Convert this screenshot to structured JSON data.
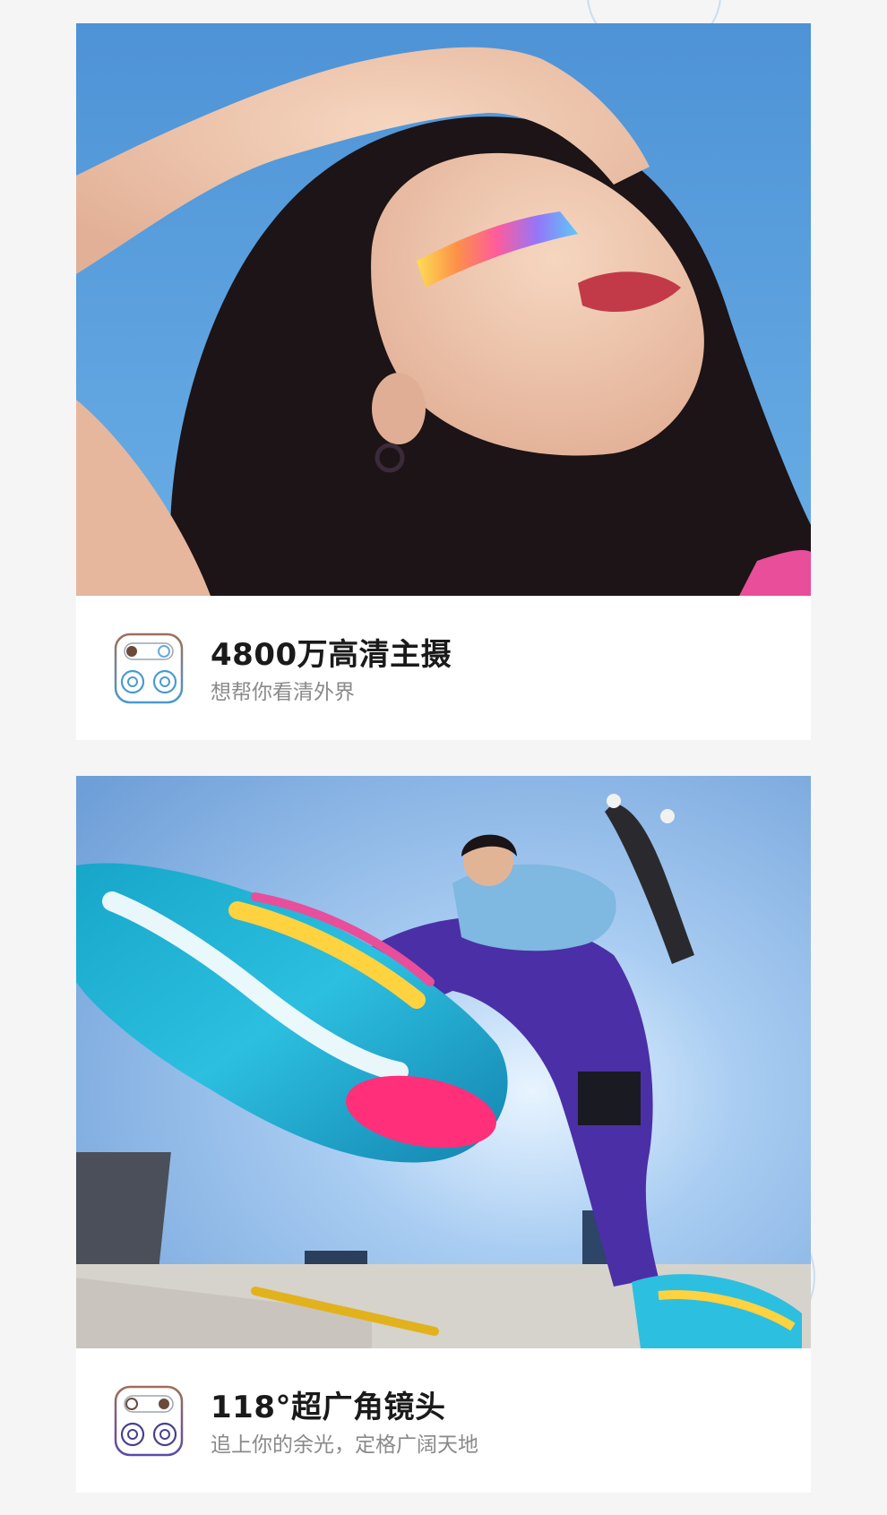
{
  "features": [
    {
      "title": "4800万高清主摄",
      "subtitle": "想帮你看清外界",
      "icon": "quad-camera-icon",
      "photo": "portrait-rainbow-light-photo"
    },
    {
      "title": "118°超广角镜头",
      "subtitle": "追上你的余光，定格广阔天地",
      "icon": "quad-camera-icon",
      "photo": "skateboarder-wide-angle-photo"
    }
  ],
  "colors": {
    "background": "#f5f5f5",
    "card": "#ffffff",
    "title": "#1a1a1a",
    "subtitle": "#8a8a8a",
    "sky": "#5b9bd5"
  }
}
